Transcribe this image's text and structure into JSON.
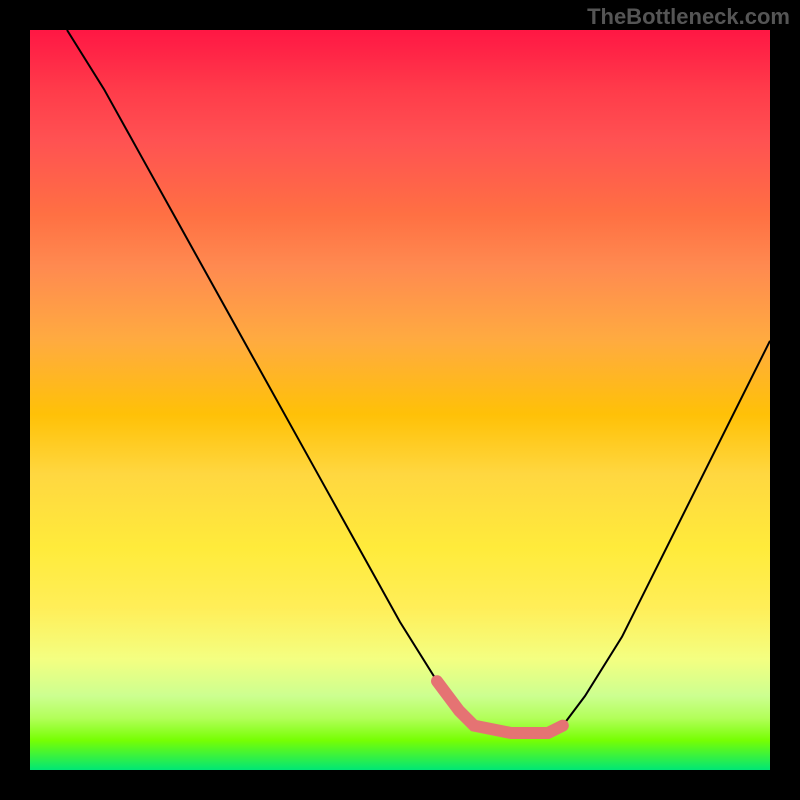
{
  "watermark": "TheBottleneck.com",
  "chart_data": {
    "type": "line",
    "title": "",
    "xlabel": "",
    "ylabel": "",
    "xlim": [
      0,
      100
    ],
    "ylim": [
      0,
      100
    ],
    "series": [
      {
        "name": "curve",
        "x": [
          5,
          10,
          15,
          20,
          25,
          30,
          35,
          40,
          45,
          50,
          55,
          58,
          60,
          65,
          70,
          72,
          75,
          80,
          85,
          90,
          95,
          100
        ],
        "y": [
          100,
          92,
          83,
          74,
          65,
          56,
          47,
          38,
          29,
          20,
          12,
          8,
          6,
          5,
          5,
          6,
          10,
          18,
          28,
          38,
          48,
          58
        ]
      }
    ],
    "highlight": {
      "name": "bottom-segment",
      "x": [
        55,
        58,
        60,
        65,
        70,
        72
      ],
      "y": [
        12,
        8,
        6,
        5,
        5,
        6
      ],
      "color": "#e57373"
    },
    "gradient_colors": {
      "top": "#ff1744",
      "middle": "#ffeb3b",
      "bottom": "#00e676"
    }
  }
}
